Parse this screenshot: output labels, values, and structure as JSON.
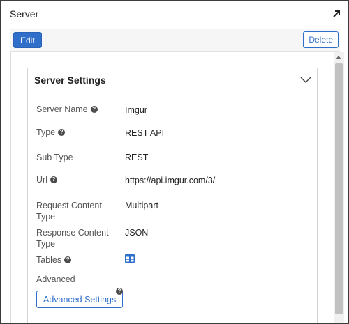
{
  "window": {
    "title": "Server"
  },
  "toolbar": {
    "edit_label": "Edit",
    "delete_label": "Delete"
  },
  "card": {
    "title": "Server Settings",
    "fields": [
      {
        "label": "Server Name",
        "value": "Imgur",
        "help": true
      },
      {
        "label": "Type",
        "value": "REST API",
        "help": true
      },
      {
        "label": "Sub Type",
        "value": "REST",
        "help": false
      },
      {
        "label": "Url",
        "value": "https://api.imgur.com/3/",
        "help": true
      },
      {
        "label_line1": "Request Content",
        "label_line2": "Type",
        "value": "Multipart"
      },
      {
        "label_line1": "Response Content",
        "label_line2": "Type",
        "value": "JSON"
      },
      {
        "label": "Tables",
        "help": true,
        "icon": "table-icon"
      },
      {
        "label": "Advanced"
      }
    ],
    "advanced_button_label": "Advanced Settings"
  },
  "help_glyph": "?",
  "colors": {
    "accent": "#2f6fc9",
    "border": "#3c3c3c"
  }
}
